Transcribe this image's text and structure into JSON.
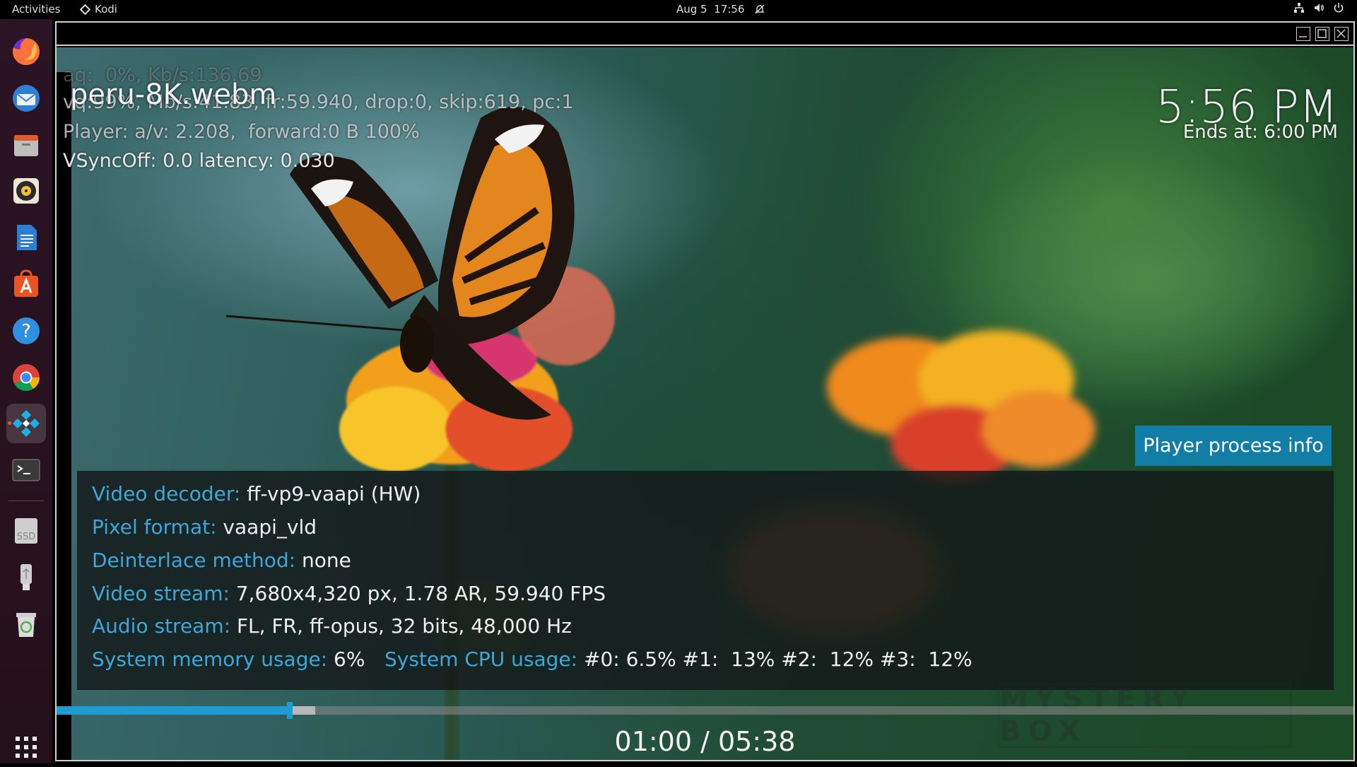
{
  "topbar": {
    "activities": "Activities",
    "app_name": "Kodi",
    "date": "Aug 5",
    "time": "17:56"
  },
  "dock": {
    "items": [
      {
        "name": "firefox",
        "color": "#ff7139"
      },
      {
        "name": "thunderbird",
        "color": "#2f7fd6"
      },
      {
        "name": "files",
        "color": "#c9c9c9"
      },
      {
        "name": "rhythmbox",
        "color": "#f2c12e"
      },
      {
        "name": "libreoffice-writer",
        "color": "#2a7fd4"
      },
      {
        "name": "ubuntu-software",
        "color": "#e95420"
      },
      {
        "name": "help",
        "color": "#2f8fe0"
      },
      {
        "name": "chrome",
        "color": "#db4437"
      },
      {
        "name": "kodi",
        "color": "#17b2e7"
      },
      {
        "name": "terminal",
        "color": "#3a3a3a"
      },
      {
        "name": "ssd-drive",
        "color": "#cfcfcf"
      },
      {
        "name": "usb-drive",
        "color": "#cfcfcf"
      },
      {
        "name": "trash",
        "color": "#8fbf7a"
      }
    ],
    "ssd_label": "SSD"
  },
  "player": {
    "file_title": "peru-8K.webm",
    "clock": "5:56 PM",
    "ends_at": "Ends at: 6:00 PM",
    "debug": {
      "line_audio": "aq:  0%, Kb/s:136.69",
      "line_video": "vq:99%, Mb/s:41.83, fr:59.940, drop:0, skip:619, pc:1",
      "line_player": "Player: a/v: 2.208,  forward:0 B 100%",
      "line_vsync": "VSyncOff: 0.0 latency: 0.030"
    },
    "process_info_button": "Player process info",
    "info": {
      "decoder_label": "Video decoder:",
      "decoder_value": " ff-vp9-vaapi (HW)",
      "pixel_label": "Pixel format:",
      "pixel_value": " vaapi_vld",
      "deinterlace_label": "Deinterlace method:",
      "deinterlace_value": " none",
      "video_label": "Video stream:",
      "video_value": " 7,680x4,320 px, 1.78 AR, 59.940 FPS",
      "audio_label": "Audio stream:",
      "audio_value": " FL, FR, ff-opus, 32 bits, 48,000 Hz",
      "memory_label": "System memory usage:",
      "memory_value": " 6%",
      "cpu_label": "System CPU usage:",
      "cpu_value": " #0: 6.5% #1:  13% #2:  12% #3:  12%"
    },
    "progress": {
      "played_fraction": 0.1801,
      "cached_fraction": 0.1994
    },
    "time_display": "01:00 / 05:38",
    "watermark": "MYSTERY BOX"
  }
}
